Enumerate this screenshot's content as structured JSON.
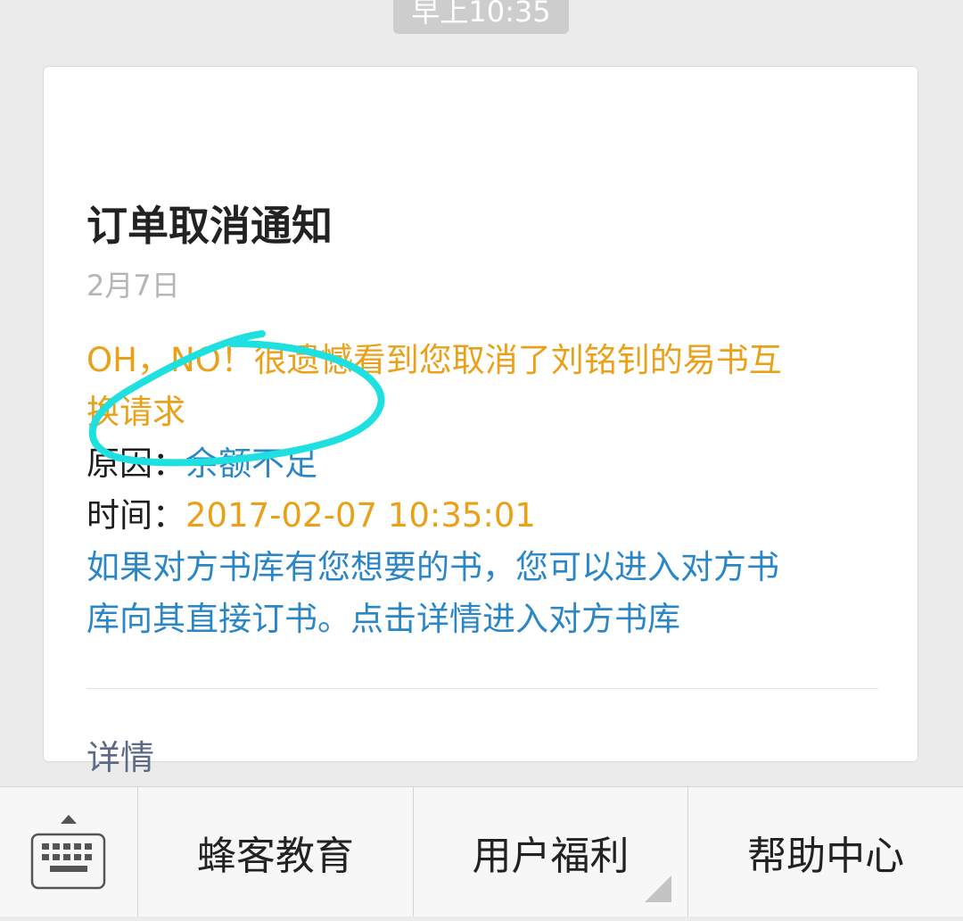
{
  "status": {
    "time": "早上10:35"
  },
  "card": {
    "title": "订单取消通知",
    "date": "2月7日",
    "line1": "OH，NO！很遗憾看到您取消了刘铭钊的易书互",
    "line2": "换请求",
    "reason_label": "原因：",
    "reason_value": "余额不足",
    "time_label": "时间：",
    "time_value": "2017-02-07 10:35:01",
    "hint_line1": "如果对方书库有您想要的书，您可以进入对方书",
    "hint_line2": "库向其直接订书。点击详情进入对方书库",
    "details_link": "详情"
  },
  "menu": {
    "keyboard_icon": "keyboard-icon",
    "items": [
      {
        "label": "蜂客教育",
        "has_submenu": false
      },
      {
        "label": "用户福利",
        "has_submenu": true
      },
      {
        "label": "帮助中心",
        "has_submenu": false
      }
    ]
  },
  "colors": {
    "accent_orange": "#e9a11a",
    "link_blue": "#2b86c5",
    "annotation_cyan": "#1fe0e0"
  }
}
